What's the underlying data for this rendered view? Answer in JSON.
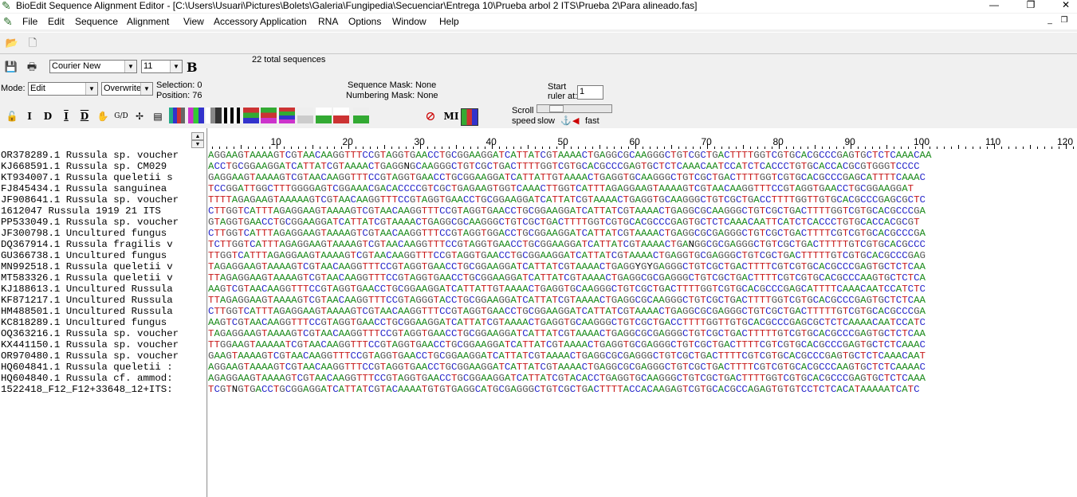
{
  "window": {
    "title": "BioEdit Sequence Alignment Editor - [C:\\Users\\Usuari\\Pictures\\Bolets\\Galeria\\Fungipedia\\Secuenciar\\Entrega 10\\Prueba arbol 2 ITS\\Prueba 2\\Para alineado.fas]"
  },
  "menu": [
    "File",
    "Edit",
    "Sequence",
    "Alignment",
    "View",
    "Accessory Application",
    "RNA",
    "Options",
    "Window",
    "Help"
  ],
  "toolbar": {
    "font_name": "Courier New",
    "font_size": "11",
    "bold_label": "B",
    "total_sequences": "22 total sequences"
  },
  "mode_bar": {
    "mode_label": "Mode:",
    "mode_value": "Edit",
    "overwrite_value": "Overwrite",
    "selection": "Selection: 0",
    "position": "Position:   76",
    "sequence_mask": "Sequence Mask: None",
    "numbering_mask": "Numbering Mask: None",
    "start_ruler_label1": "Start",
    "start_ruler_label2": "ruler at:",
    "start_ruler_value": "1"
  },
  "scroll": {
    "label1": "Scroll",
    "label2": "speed",
    "slow": "slow",
    "fast": "fast",
    "mi_label": "MI"
  },
  "ruler": [
    "10",
    "20",
    "30",
    "40",
    "50",
    "60",
    "70",
    "80",
    "90",
    "100",
    "110",
    "120"
  ],
  "sequences": [
    {
      "name": "OR378289.1 Russula sp. voucher",
      "seq": "AGGAAGTAAAAGTCGTAACAAGGTTTCCGTAGGTGAACCTGCGGAAGGATCATTATCGTAAAACTGAGGCGCAAGGGCTGTCGCTGACTTTTGGTCGTGCACGCCCGAGTGCTCTCAAACAA"
    },
    {
      "name": "KJ668591.1 Russula sp. CM029",
      "seq": "ACCTGCGGAAGGATCATTATCGTAAAACTGAGGNGCAAGGGCTGTCGCTGACTTTTGGTCGTGCACGCCCGAGTGCTCTCAAACAATCCATCTCACCCTGTGCACCACGCGTGGGTCCCC"
    },
    {
      "name": "KT934007.1 Russula queletii s",
      "seq": "GAGGAAGTAAAAGTCGTAACAAGGTTTCCGTAGGTGAACCTGCGGAAGGATCATTATTGTAAAACTGAGGTGCAAGGGCTGTCGCTGACTTTTGGTCGTGCACGCCCGAGCATTTTCAAAC"
    },
    {
      "name": "FJ845434.1 Russula sanguinea",
      "seq": "TCCGGATTGGCTTTGGGGAGTCGGAAACGACACCCCGTCGCTGAGAAGTGGTCAAACTTGGTCATTTAGAGGAAGTAAAAGTCGTAACAAGGTTTCCGTAGGTGAACCTGCGGAAGGAT"
    },
    {
      "name": "JF908641.1 Russula sp. voucher",
      "seq": "TTTTAGAGAAGTAAAAAGTCGTAACAAGGTTTCCGTAGGTGAACCTGCGGAAGGATCATTATCGTAAAACTGAGGTGCAAGGGCTGTCGCTGACCTTTTGGTTGTGCACGCCCGAGCGCTC"
    },
    {
      "name": "1612047 Russula 1919 21 ITS",
      "seq": "CTTGGTCATTTAGAGGAAGTAAAAGTCGTAACAAGGTTTCCGTAGGTGAACCTGCGGAAGGATCATTATCGTAAAACTGAGGCGCAAGGGCTGTCGCTGACTTTTGGTCGTGCACGCCCGA"
    },
    {
      "name": "PP533049.1 Russula sp. voucher",
      "seq": "GTAGGTGAACCTGCGGAAGGATCATTATCGTAAAACTGAGGCGCAAGGGCTGTCGCTGACTTTTGGTCGTGCACGCCCGAGTGCTCTCAAACAATTCATCTCACCCTGTGCACCACGCGT"
    },
    {
      "name": "JF300798.1 Uncultured fungus",
      "seq": "CTTGGTCATTTAGAGGAAGTAAAAGTCGTAACAAGGTTTCCGTAGGTGGACCTGCGGAAGGATCATTATCGTAAAACTGAGGCGCGAGGGCTGTCGCTGACTTTTCGTCGTGCACGCCCGA"
    },
    {
      "name": "DQ367914.1 Russula fragilis v",
      "seq": "TCTTGGTCATTTAGAGGAAGTAAAAGTCGTAACAAGGTTTCCGTAGGTGAACCTGCGGAAGGATCATTATCGTAAAACTGANGGCGCGAGGGCTGTCGCTGACTTTTTGTCGTGCACGCCC"
    },
    {
      "name": "GU366738.1 Uncultured fungus",
      "seq": "TTGGTCATTTAGAGGAAGTAAAAGTCGTAACAAGGTTTCCGTAGGTGAACCTGCGGAAGGATCATTATCGTAAAACTGAGGTGCGAGGGCTGTCGCTGACTTTTTGTCGTGCACGCCCGAG"
    },
    {
      "name": "MN992518.1 Russula queletii v",
      "seq": "TAGAGGAAGTAAAAGTCGTAACAAGGTTTCCGTAGGTGAACCTGCGGAAGGATCATTATCGTAAAACTGAGGYGYGAGGGCTGTCGCTGACTTTTCGTCGTGCACGCCCGAGTGCTCTCAA"
    },
    {
      "name": "MT583326.1 Russula queletii v",
      "seq": "TTAGAGGAAGTAAAAGTCGTAACAAGGTTTCCGTAGGTGAACCTGCGGAAGGATCATTATCGTAAAACTGAGGCGCGAGGGCTGTCGCTGACTTTTCGTCGTGCACGCCCAAGTGCTCTCA"
    },
    {
      "name": "KJ188613.1 Uncultured Russula",
      "seq": "AAGTCGTAACAAGGTTTCCGTAGGTGAACCTGCGGAAGGATCATTATTGTAAAACTGAGGTGCAAGGGCTGTCGCTGACTTTTGGTCGTGCACGCCCGAGCATTTTCAAACAATCCATCTC"
    },
    {
      "name": "KF871217.1 Uncultured Russula",
      "seq": "TTAGAGGAAGTAAAAGTCGTAACAAGGTTTCCGTAGGGTACCTGCGGAAGGATCATTATCGTAAAACTGAGGCGCAAGGGCTGTCGCTGACTTTTGGTCGTGCACGCCCGAGTGCTCTCAA"
    },
    {
      "name": "HM488501.1 Uncultured Russula",
      "seq": "CTTGGTCATTTAGAGGAAGTAAAAGTCGTAACAAGGTTTCCGTAGGTGAACCTGCGGAAGGATCATTATCGTAAAACTGAGGCGCGAGGGCTGTCGCTGACTTTTTGTCGTGCACGCCCGA"
    },
    {
      "name": "KC818289.1 Uncultured fungus",
      "seq": "AAGTCGTAACAAGGTTTCCGTAGGTGAACCTGCGGAAGGATCATTATCGTAAAACTGAGGTGCAAGGGCTGTCGCTGACCTTTTGGTTGTGCACGCCCGAGCGCTCTCAAAACAATCCATC"
    },
    {
      "name": "OQ363216.1 Russula sp. voucher",
      "seq": "TAGAGGAAGTAAAAGTCGTAACAAGGTTTCCGTAGGTGAACCTGCGGAAGGATCATTATCGTAAAACTGAGGCGCGAGGGCTGTCGCTGACTTTTTGTCGTGCACGCCCGAGTGCTCTCAA"
    },
    {
      "name": "KX441150.1 Russula sp. voucher",
      "seq": "TTGGAAGTAAAAATCGTAACAAGGTTTCCGTAGGTGAACCTGCGGAAGGATCATTATCGTAAAACTGAGGTGCGAGGGCTGTCGCTGACTTTTCGTCGTGCACGCCCGAGTGCTCTCAAAC"
    },
    {
      "name": "OR970480.1 Russula sp. voucher",
      "seq": "GAAGTAAAAGTCGTAACAAGGTTTCCGTAGGTGAACCTGCGGAAGGATCATTATCGTAAAACTGAGGCGCGAGGGCTGTCGCTGACTTTTCGTCGTGCACGCCCGAGTGCTCTCAAACAAT"
    },
    {
      "name": "HQ604841.1 Russula queletii :",
      "seq": "AGGAAGTAAAAGTCGTAACAAGGTTTCCGTAGGTGAACCTGCGGAAGGATCATTATCGTAAAACTGAGGCGCGAGGGCTGTCGCTGACTTTTCGTCGTGCACGCCCAAGTGCTCTCAAAAC"
    },
    {
      "name": "HQ604840.1 Russula cf. ammod:",
      "seq": "AGAGGAAGTAAAAGTCGTAACAAGGTTTCCGTAGGTGAACCTGCGGAAGGATCATTATCGTACACCTGAGGTGCAAGGGCTGTCGCTGACTTTTGGTCGTGCACGCCCGAGTGCTCTCAAA"
    },
    {
      "name": "1522418_F12_F12+33648_12+ITS:",
      "seq": "TCGTNGTGACCTGCGGAGGATCATTATCGTACAAAATGTGTGAGGCATGCGAGGGCTGTCGCTGACTTTTACCACAAGAGTCGTGCACGCCAGAGTGTGTCCTCTCACATAAAAATCATC"
    }
  ],
  "colors": {
    "A": "#1b8a1b",
    "C": "#1f1fc8",
    "G": "#555555",
    "T": "#c81a1a"
  }
}
